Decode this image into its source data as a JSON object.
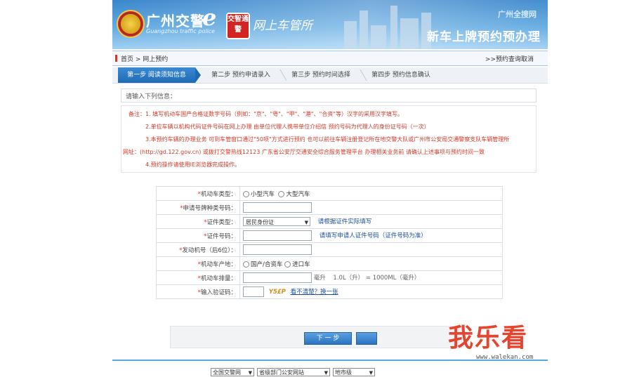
{
  "header": {
    "logo_cn": "广州交警",
    "logo_e": "e",
    "logo_en": "Guangzhou traffic police",
    "badge_text": "交智通警",
    "hall_title": "网上车管所",
    "city": "广州全搜网",
    "service_title": "新车上牌预约预办理"
  },
  "breadcrumb": {
    "path": "首页 > 网上预约",
    "back_link": ">>预约查询取消"
  },
  "steps": [
    {
      "label": "第一步 阅读须知信息",
      "active": true
    },
    {
      "label": "第二步 预约申请录入",
      "active": false
    },
    {
      "label": "第三步 预约时间选择",
      "active": false
    },
    {
      "label": "第四步 预约信息确认",
      "active": false
    }
  ],
  "section_title": "请输入下列信息：",
  "notice": {
    "lines": [
      "备注：1. 填写机动车国产合格证数字号码（例如：\"京\"、\"粤\"、\"甲\"、\"港\"、\"合资\"等）汉字的采用汉字填写。",
      "2.单位车辆以机构代码证件号码在网上办理 由单位代理人携带单位介绍信 预约号码为代理人的身份证号码（一次）",
      "3.本预约车辆的办理业务 可到车管窗口通过\"50项\"方式进行预约 也可以前往车辆注册登记所在地交警大队或广州市公安局交通警察支队车辆管理所",
      "网址：(http://gd.122.gov.cn) 或拨打交警热线12123 广东省公安厅交通安全综合服务管理平台 办理相关业务前 请确认上述事项与预约时间一致",
      "4.预约操作请使用IE浏览器完成操作。"
    ]
  },
  "form": {
    "rows": [
      {
        "label": "机动车类型",
        "type": "radio",
        "options": [
          "小型汽车",
          "大型汽车"
        ]
      },
      {
        "label": "申请号牌种类号码",
        "type": "input",
        "hint": ""
      },
      {
        "label": "证件类型",
        "type": "select",
        "value": "居民身份证",
        "hint": "请根据证件实际填写"
      },
      {
        "label": "证件号码",
        "type": "input",
        "hint": "请填写申请人证件号码（证件号码为准）"
      },
      {
        "label": "发动机号（后6位）",
        "type": "input",
        "hint": ""
      },
      {
        "label": "机动车产地",
        "type": "radio",
        "options": [
          "国产/合资车",
          "进口车"
        ]
      },
      {
        "label": "机动车排量",
        "type": "displacement",
        "unit": "毫升",
        "hint": "1.0L（升） = 1000ML（毫升）"
      },
      {
        "label": "输入验证码",
        "type": "captcha",
        "captcha_text": "Y5£P",
        "refresh_text": "看不清楚？换一张"
      }
    ]
  },
  "submit": {
    "label": "下 一 步"
  },
  "footer": {
    "select1": "全国交警网",
    "select2": "省级部门公安网站",
    "select3": "地市级"
  },
  "watermark": {
    "cn": "我乐看",
    "url": "www.walekan.com"
  },
  "colors": {
    "accent": "#2b73bf",
    "notice_red": "#d33a2a",
    "link_blue": "#1b4fa0"
  }
}
